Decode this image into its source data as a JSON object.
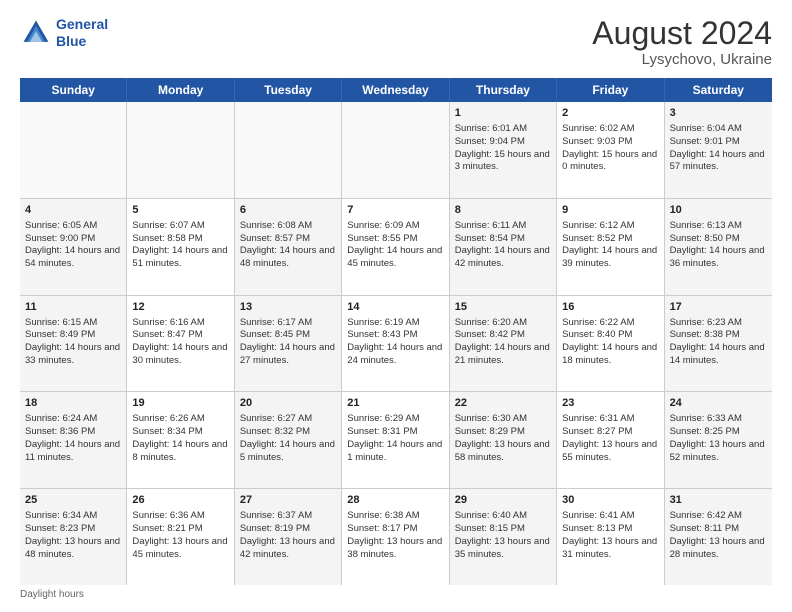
{
  "header": {
    "logo_line1": "General",
    "logo_line2": "Blue",
    "month_year": "August 2024",
    "location": "Lysychovo, Ukraine"
  },
  "days_of_week": [
    "Sunday",
    "Monday",
    "Tuesday",
    "Wednesday",
    "Thursday",
    "Friday",
    "Saturday"
  ],
  "footer": {
    "daylight_label": "Daylight hours"
  },
  "weeks": [
    [
      {
        "day": "",
        "info": ""
      },
      {
        "day": "",
        "info": ""
      },
      {
        "day": "",
        "info": ""
      },
      {
        "day": "",
        "info": ""
      },
      {
        "day": "1",
        "sunrise": "Sunrise: 6:01 AM",
        "sunset": "Sunset: 9:04 PM",
        "daylight": "Daylight: 15 hours and 3 minutes."
      },
      {
        "day": "2",
        "sunrise": "Sunrise: 6:02 AM",
        "sunset": "Sunset: 9:03 PM",
        "daylight": "Daylight: 15 hours and 0 minutes."
      },
      {
        "day": "3",
        "sunrise": "Sunrise: 6:04 AM",
        "sunset": "Sunset: 9:01 PM",
        "daylight": "Daylight: 14 hours and 57 minutes."
      }
    ],
    [
      {
        "day": "4",
        "sunrise": "Sunrise: 6:05 AM",
        "sunset": "Sunset: 9:00 PM",
        "daylight": "Daylight: 14 hours and 54 minutes."
      },
      {
        "day": "5",
        "sunrise": "Sunrise: 6:07 AM",
        "sunset": "Sunset: 8:58 PM",
        "daylight": "Daylight: 14 hours and 51 minutes."
      },
      {
        "day": "6",
        "sunrise": "Sunrise: 6:08 AM",
        "sunset": "Sunset: 8:57 PM",
        "daylight": "Daylight: 14 hours and 48 minutes."
      },
      {
        "day": "7",
        "sunrise": "Sunrise: 6:09 AM",
        "sunset": "Sunset: 8:55 PM",
        "daylight": "Daylight: 14 hours and 45 minutes."
      },
      {
        "day": "8",
        "sunrise": "Sunrise: 6:11 AM",
        "sunset": "Sunset: 8:54 PM",
        "daylight": "Daylight: 14 hours and 42 minutes."
      },
      {
        "day": "9",
        "sunrise": "Sunrise: 6:12 AM",
        "sunset": "Sunset: 8:52 PM",
        "daylight": "Daylight: 14 hours and 39 minutes."
      },
      {
        "day": "10",
        "sunrise": "Sunrise: 6:13 AM",
        "sunset": "Sunset: 8:50 PM",
        "daylight": "Daylight: 14 hours and 36 minutes."
      }
    ],
    [
      {
        "day": "11",
        "sunrise": "Sunrise: 6:15 AM",
        "sunset": "Sunset: 8:49 PM",
        "daylight": "Daylight: 14 hours and 33 minutes."
      },
      {
        "day": "12",
        "sunrise": "Sunrise: 6:16 AM",
        "sunset": "Sunset: 8:47 PM",
        "daylight": "Daylight: 14 hours and 30 minutes."
      },
      {
        "day": "13",
        "sunrise": "Sunrise: 6:17 AM",
        "sunset": "Sunset: 8:45 PM",
        "daylight": "Daylight: 14 hours and 27 minutes."
      },
      {
        "day": "14",
        "sunrise": "Sunrise: 6:19 AM",
        "sunset": "Sunset: 8:43 PM",
        "daylight": "Daylight: 14 hours and 24 minutes."
      },
      {
        "day": "15",
        "sunrise": "Sunrise: 6:20 AM",
        "sunset": "Sunset: 8:42 PM",
        "daylight": "Daylight: 14 hours and 21 minutes."
      },
      {
        "day": "16",
        "sunrise": "Sunrise: 6:22 AM",
        "sunset": "Sunset: 8:40 PM",
        "daylight": "Daylight: 14 hours and 18 minutes."
      },
      {
        "day": "17",
        "sunrise": "Sunrise: 6:23 AM",
        "sunset": "Sunset: 8:38 PM",
        "daylight": "Daylight: 14 hours and 14 minutes."
      }
    ],
    [
      {
        "day": "18",
        "sunrise": "Sunrise: 6:24 AM",
        "sunset": "Sunset: 8:36 PM",
        "daylight": "Daylight: 14 hours and 11 minutes."
      },
      {
        "day": "19",
        "sunrise": "Sunrise: 6:26 AM",
        "sunset": "Sunset: 8:34 PM",
        "daylight": "Daylight: 14 hours and 8 minutes."
      },
      {
        "day": "20",
        "sunrise": "Sunrise: 6:27 AM",
        "sunset": "Sunset: 8:32 PM",
        "daylight": "Daylight: 14 hours and 5 minutes."
      },
      {
        "day": "21",
        "sunrise": "Sunrise: 6:29 AM",
        "sunset": "Sunset: 8:31 PM",
        "daylight": "Daylight: 14 hours and 1 minute."
      },
      {
        "day": "22",
        "sunrise": "Sunrise: 6:30 AM",
        "sunset": "Sunset: 8:29 PM",
        "daylight": "Daylight: 13 hours and 58 minutes."
      },
      {
        "day": "23",
        "sunrise": "Sunrise: 6:31 AM",
        "sunset": "Sunset: 8:27 PM",
        "daylight": "Daylight: 13 hours and 55 minutes."
      },
      {
        "day": "24",
        "sunrise": "Sunrise: 6:33 AM",
        "sunset": "Sunset: 8:25 PM",
        "daylight": "Daylight: 13 hours and 52 minutes."
      }
    ],
    [
      {
        "day": "25",
        "sunrise": "Sunrise: 6:34 AM",
        "sunset": "Sunset: 8:23 PM",
        "daylight": "Daylight: 13 hours and 48 minutes."
      },
      {
        "day": "26",
        "sunrise": "Sunrise: 6:36 AM",
        "sunset": "Sunset: 8:21 PM",
        "daylight": "Daylight: 13 hours and 45 minutes."
      },
      {
        "day": "27",
        "sunrise": "Sunrise: 6:37 AM",
        "sunset": "Sunset: 8:19 PM",
        "daylight": "Daylight: 13 hours and 42 minutes."
      },
      {
        "day": "28",
        "sunrise": "Sunrise: 6:38 AM",
        "sunset": "Sunset: 8:17 PM",
        "daylight": "Daylight: 13 hours and 38 minutes."
      },
      {
        "day": "29",
        "sunrise": "Sunrise: 6:40 AM",
        "sunset": "Sunset: 8:15 PM",
        "daylight": "Daylight: 13 hours and 35 minutes."
      },
      {
        "day": "30",
        "sunrise": "Sunrise: 6:41 AM",
        "sunset": "Sunset: 8:13 PM",
        "daylight": "Daylight: 13 hours and 31 minutes."
      },
      {
        "day": "31",
        "sunrise": "Sunrise: 6:42 AM",
        "sunset": "Sunset: 8:11 PM",
        "daylight": "Daylight: 13 hours and 28 minutes."
      }
    ]
  ]
}
